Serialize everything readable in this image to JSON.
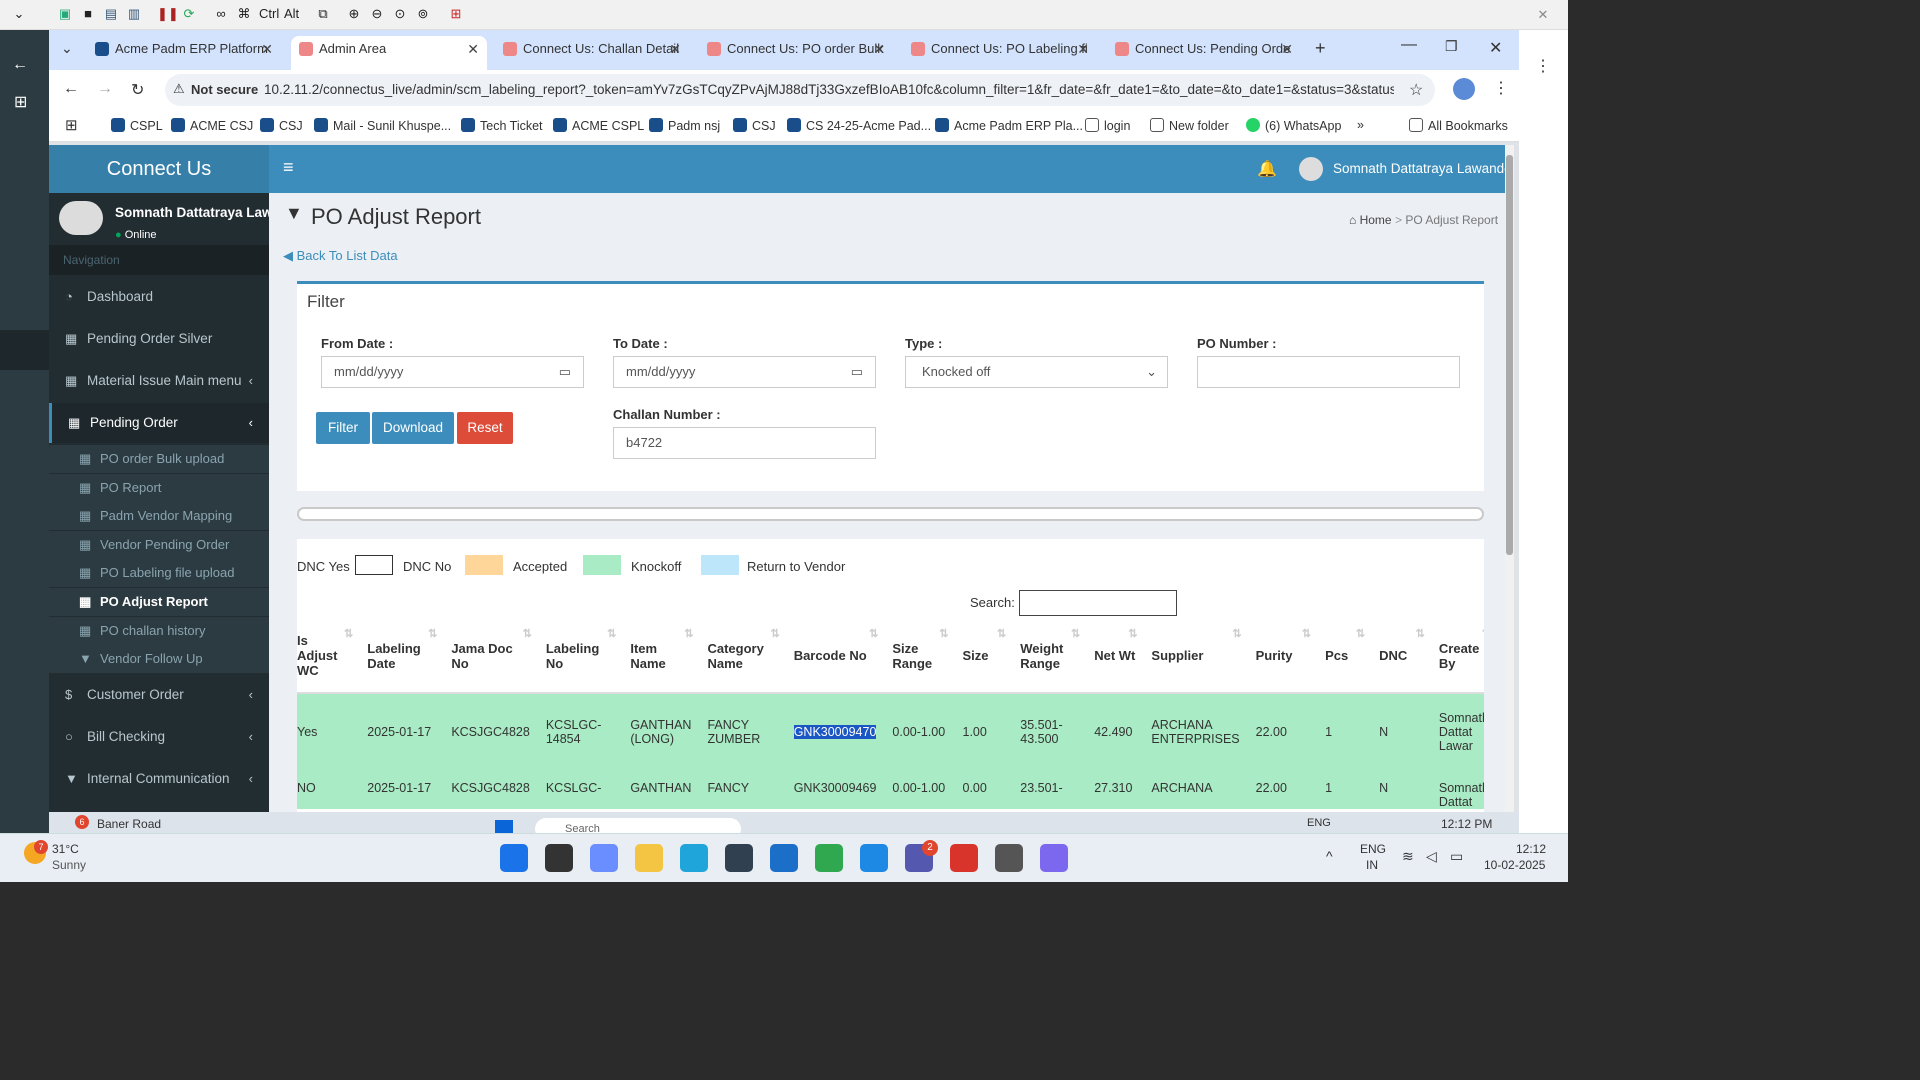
{
  "rd_toolbar": {
    "ctrl_label": "Ctrl",
    "alt_label": "Alt"
  },
  "browser": {
    "tabs": [
      {
        "label": "Acme Padm ERP Platform"
      },
      {
        "label": "Admin Area"
      },
      {
        "label": "Connect Us: Challan Detail"
      },
      {
        "label": "Connect Us: PO order Bulk"
      },
      {
        "label": "Connect Us: PO Labeling fi"
      },
      {
        "label": "Connect Us: Pending Orde"
      }
    ],
    "security_label": "Not secure",
    "url": "10.2.11.2/connectus_live/admin/scm_labeling_report?_token=amYv7zGsTCqyZPvAjMJ88dTj33GxzefBIoAB10fc&column_filter=1&fr_date=&fr_date1=&to_date=&to_date1=&status=3&status...",
    "bookmarks": [
      "CSPL",
      "ACME CSJ",
      "CSJ",
      "Mail - Sunil Khuspe...",
      "Tech Ticket",
      "ACME CSPL",
      "Padm nsj",
      "CSJ",
      "CS 24-25-Acme Pad...",
      "Acme Padm ERP Pla...",
      "login",
      "New folder",
      "(6) WhatsApp"
    ],
    "all_bookmarks": "All Bookmarks",
    "bookmarks_more": "»"
  },
  "app": {
    "brand": "Connect Us",
    "user_name": "Somnath Dattatraya Lawande",
    "sidebar_user": "Somnath Dattatraya Lawar",
    "status": "Online",
    "nav_header": "Navigation",
    "nav": [
      {
        "label": "Dashboard"
      },
      {
        "label": "Pending Order Silver"
      },
      {
        "label": "Material Issue Main menu"
      },
      {
        "label": "Pending Order"
      }
    ],
    "sub": [
      {
        "label": "PO order Bulk upload"
      },
      {
        "label": "PO Report"
      },
      {
        "label": "Padm Vendor Mapping"
      },
      {
        "label": "Vendor Pending Order"
      },
      {
        "label": "PO Labeling file upload"
      },
      {
        "label": "PO Adjust Report"
      },
      {
        "label": "PO challan history"
      },
      {
        "label": "Vendor Follow Up"
      }
    ],
    "nav2": [
      {
        "label": "Customer Order"
      },
      {
        "label": "Bill Checking"
      },
      {
        "label": "Internal Communication"
      }
    ]
  },
  "page": {
    "title": "PO Adjust Report",
    "crumb_home": "Home",
    "crumb_sep": ">",
    "crumb_current": "PO Adjust Report",
    "back_link": "Back To List Data",
    "filter_title": "Filter",
    "from_label": "From Date :",
    "from_value": "mm/dd/yyyy",
    "to_label": "To Date :",
    "to_value": "mm/dd/yyyy",
    "type_label": "Type :",
    "type_value": "Knocked off",
    "po_label": "PO Number :",
    "po_value": "",
    "challan_label": "Challan Number :",
    "challan_value": "b4722",
    "btn_filter": "Filter",
    "btn_download": "Download",
    "btn_reset": "Reset",
    "legend": [
      {
        "label": "DNC Yes",
        "color": "#ffffff"
      },
      {
        "label": "DNC No",
        "color": "#ffffff"
      },
      {
        "label": "Accepted",
        "color": "#ffd699"
      },
      {
        "label": "Knockoff",
        "color": "#a8ebc4"
      },
      {
        "label": "Return to Vendor",
        "color": "#bde6fb"
      }
    ],
    "search_label": "Search:",
    "columns": [
      "Is Adjust WC",
      "Labeling Date",
      "Jama Doc No",
      "Labeling No",
      "Item Name",
      "Category Name",
      "Barcode No",
      "Size Range",
      "Size",
      "Weight Range",
      "Net Wt",
      "Supplier",
      "Purity",
      "Pcs",
      "DNC",
      "Create By"
    ],
    "rows": [
      [
        "Yes",
        "2025-01-17",
        "KCSJGC4828",
        "KCSLGC-14854",
        "GANTHAN (LONG)",
        "FANCY ZUMBER",
        "GNK30009470",
        "0.00-1.00",
        "1.00",
        "35.501-43.500",
        "42.490",
        "ARCHANA ENTERPRISES",
        "22.00",
        "1",
        "N",
        "Somnath Dattat Lawar"
      ],
      [
        "NO",
        "2025-01-17",
        "KCSJGC4828",
        "KCSLGC-",
        "GANTHAN",
        "FANCY",
        "GNK30009469",
        "0.00-1.00",
        "0.00",
        "23.501-",
        "27.310",
        "ARCHANA",
        "22.00",
        "1",
        "N",
        "Somnath Dattat"
      ]
    ],
    "row_color": "#a8ebc4"
  },
  "taskbar": {
    "weather_temp": "31°C",
    "weather_text": "Sunny",
    "weather_badge": "7",
    "lang1": "ENG",
    "lang2": "IN",
    "time": "12:12",
    "date": "10-02-2025",
    "teams_badge": "2"
  },
  "remote_taskbar": {
    "notif_badge": "6",
    "location": "Baner Road",
    "search": "Search",
    "lang": "ENG",
    "time": "12:12 PM"
  },
  "colors": {
    "accent": "#3c8dbc",
    "sidebar": "#222d32",
    "reset": "#dd4b39"
  }
}
